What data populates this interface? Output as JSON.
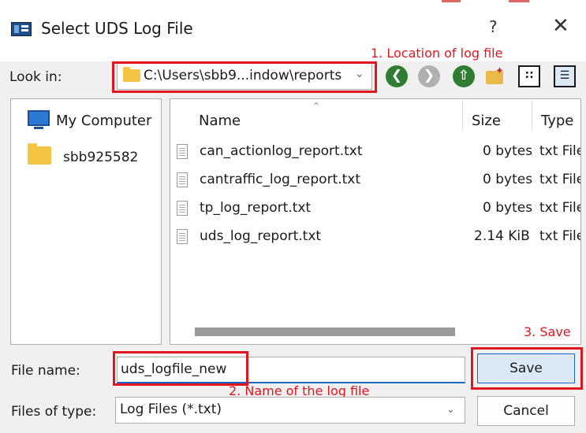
{
  "window": {
    "title": "Select UDS Log File",
    "help_label": "?",
    "close_label": "✕"
  },
  "toolbar": {
    "lookin_label": "Look in:",
    "lookin_path": "C:\\Users\\sbb9...indow\\reports",
    "buttons": [
      {
        "name": "back",
        "icon": "back-arrow-icon"
      },
      {
        "name": "forward",
        "icon": "forward-arrow-icon"
      },
      {
        "name": "up",
        "icon": "up-arrow-icon"
      },
      {
        "name": "new-folder",
        "icon": "new-folder-icon"
      },
      {
        "name": "list-view",
        "icon": "list-view-icon"
      },
      {
        "name": "detail-view",
        "icon": "detail-view-icon"
      }
    ]
  },
  "sidebar": {
    "items": [
      {
        "label": "My Computer",
        "icon": "computer-icon"
      },
      {
        "label": "sbb925582",
        "icon": "folder-icon"
      }
    ]
  },
  "file_list": {
    "columns": [
      "Name",
      "Size",
      "Type"
    ],
    "rows": [
      {
        "name": "can_actionlog_report.txt",
        "size": "0 bytes",
        "type": "txt File"
      },
      {
        "name": "cantraffic_log_report.txt",
        "size": "0 bytes",
        "type": "txt File"
      },
      {
        "name": "tp_log_report.txt",
        "size": "0 bytes",
        "type": "txt File"
      },
      {
        "name": "uds_log_report.txt",
        "size": "2.14 KiB",
        "type": "txt File"
      }
    ]
  },
  "bottom": {
    "filename_label": "File name:",
    "filename_value": "uds_logfile_new",
    "filetype_label": "Files of type:",
    "filetype_value": "Log Files (*.txt)",
    "save_label": "Save",
    "cancel_label": "Cancel"
  },
  "annotations": {
    "location": "1. Location of log file",
    "name": "2. Name of the log file",
    "save": "3. Save"
  },
  "colors": {
    "annotation": "#e0161f",
    "accent": "#1a66c4",
    "nav_green": "#2e7d32"
  }
}
